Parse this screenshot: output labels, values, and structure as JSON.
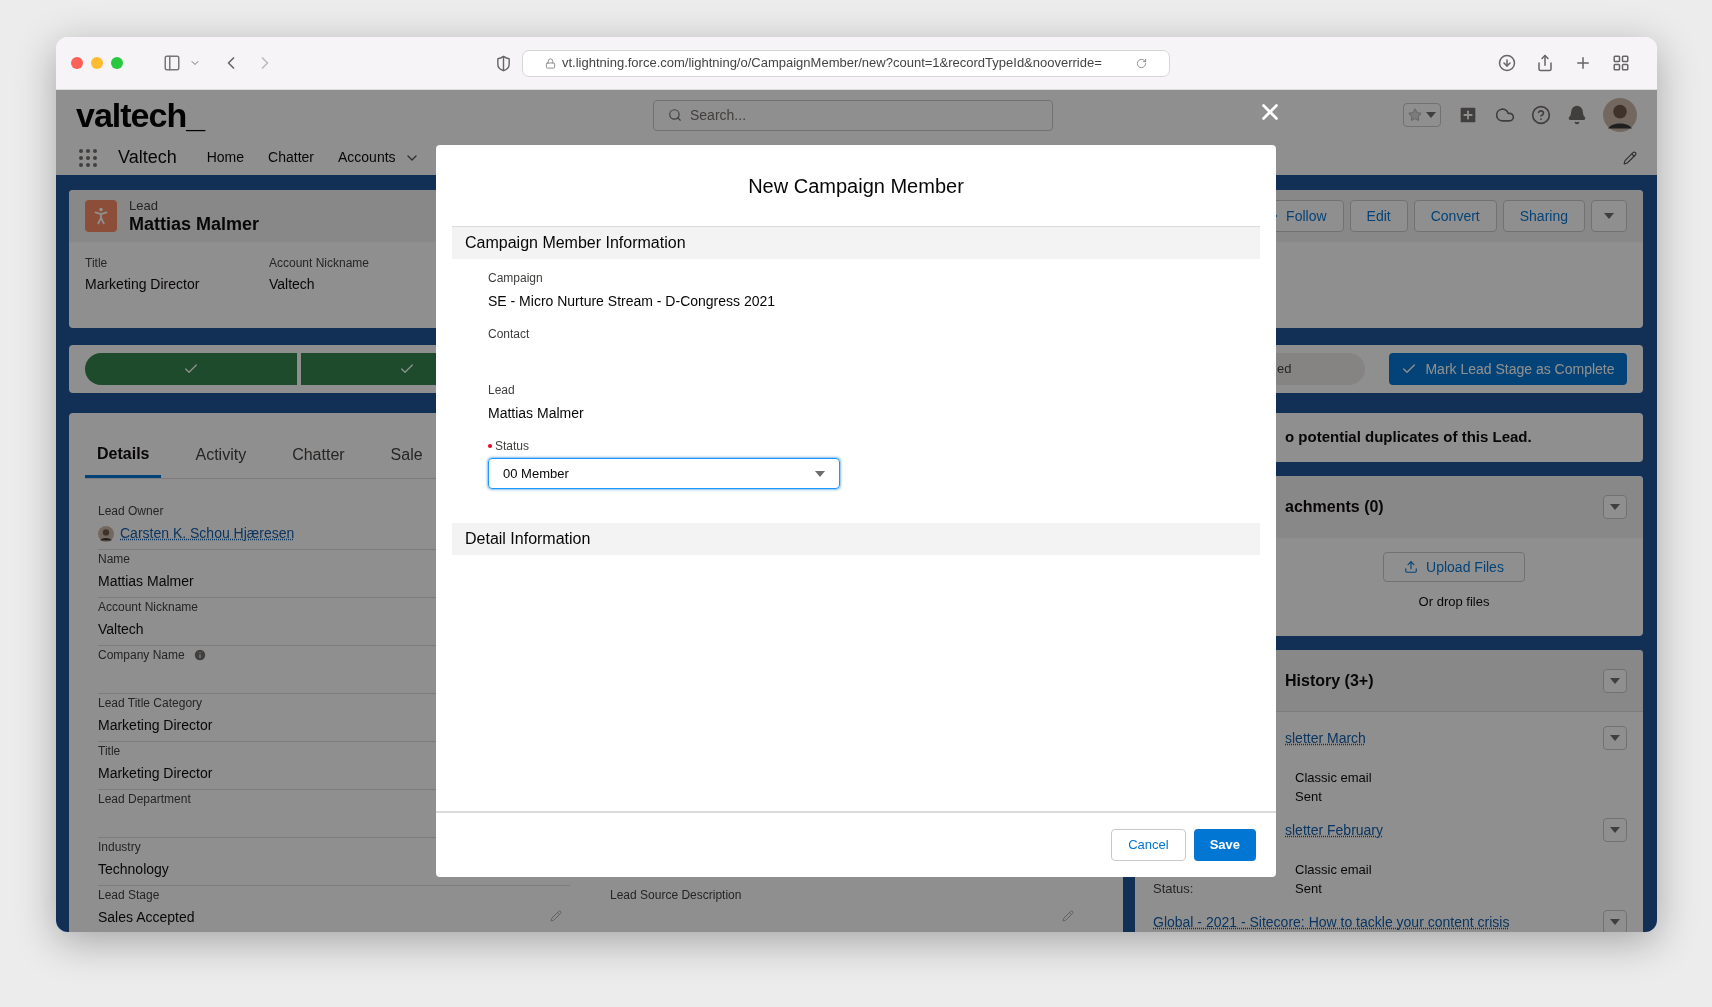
{
  "browser": {
    "url": "vt.lightning.force.com/lightning/o/CampaignMember/new?count=1&recordTypeId&nooverride="
  },
  "app": {
    "logo": "valtech_",
    "search_placeholder": "Search...",
    "app_name": "Valtech",
    "nav": [
      {
        "label": "Home",
        "has_menu": false
      },
      {
        "label": "Chatter",
        "has_menu": false
      },
      {
        "label": "Accounts",
        "has_menu": true
      }
    ]
  },
  "record": {
    "type": "Lead",
    "name": "Mattias Malmer",
    "highlights": [
      {
        "label": "Title",
        "value": "Marketing Director"
      },
      {
        "label": "Account Nickname",
        "value": "Valtech"
      }
    ],
    "actions": [
      {
        "label": "Follow",
        "kind": "follow"
      },
      {
        "label": "Edit",
        "kind": "plain"
      },
      {
        "label": "Convert",
        "kind": "plain"
      },
      {
        "label": "Sharing",
        "kind": "plain"
      }
    ]
  },
  "path": {
    "stages": [
      {
        "complete": true
      },
      {
        "complete": true
      }
    ],
    "current_stage": "ed",
    "complete_button": "Mark Lead Stage as Complete"
  },
  "tabs": [
    {
      "label": "Details",
      "selected": true
    },
    {
      "label": "Activity",
      "selected": false
    },
    {
      "label": "Chatter",
      "selected": false
    },
    {
      "label": "Sale",
      "selected": false
    }
  ],
  "fields": [
    {
      "label": "Lead Owner",
      "value": "Carsten K. Schou Hjæresen",
      "kind": "user"
    },
    {
      "label": "Name",
      "value": "Mattias Malmer",
      "kind": "text"
    },
    {
      "label": "Account Nickname",
      "value": "Valtech",
      "kind": "text"
    },
    {
      "label": "Company Name",
      "kind": "info"
    },
    {
      "label": "Lead Title Category",
      "value": "Marketing Director",
      "kind": "text"
    },
    {
      "label": "Title",
      "value": "Marketing Director",
      "kind": "text"
    },
    {
      "label": "Lead Department",
      "kind": "text"
    },
    {
      "label": "Industry",
      "value": "Technology",
      "kind": "text"
    },
    {
      "label": "Lead Stage",
      "value": "Sales Accepted",
      "kind": "editable"
    }
  ],
  "paired_field": {
    "label": "Lead Source Description",
    "kind": "editable"
  },
  "sidebar": {
    "duplicates": "o potential duplicates of this Lead.",
    "attachments": {
      "title": "achments (0)",
      "upload": "Upload Files",
      "drop": "Or drop files"
    },
    "history": {
      "title": "History (3+)",
      "items": [
        {
          "link": "sletter March",
          "rows": [
            {
              "value": "Classic email"
            },
            {
              "value": "Sent"
            }
          ]
        },
        {
          "link": "sletter February",
          "rows": [
            {
              "value": "Classic email"
            },
            {
              "label": "Status:",
              "value": "Sent"
            }
          ]
        },
        {
          "link": "Global - 2021 - Sitecore: How to tackle your content crisis"
        }
      ]
    }
  },
  "modal": {
    "title": "New Campaign Member",
    "sections": [
      {
        "title": "Campaign Member Information",
        "fields": [
          {
            "label": "Campaign",
            "value": "SE - Micro Nurture Stream - D-Congress 2021",
            "kind": "text",
            "required": false
          },
          {
            "label": "Contact",
            "kind": "text",
            "required": false
          },
          {
            "label": "Lead",
            "value": "Mattias Malmer",
            "kind": "text",
            "required": false
          },
          {
            "label": "Status",
            "value": "00 Member",
            "kind": "select",
            "required": true
          }
        ]
      },
      {
        "title": "Detail Information"
      }
    ],
    "buttons": [
      {
        "label": "Cancel",
        "kind": "neutral"
      },
      {
        "label": "Save",
        "kind": "brand"
      }
    ]
  }
}
